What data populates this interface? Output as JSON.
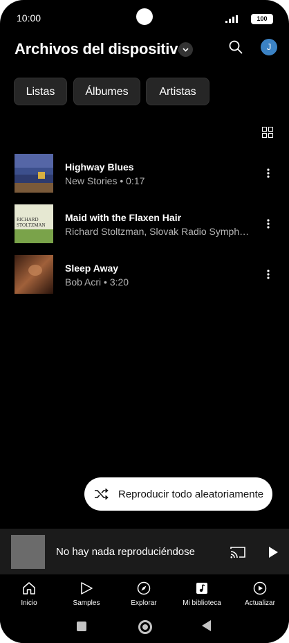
{
  "status_bar": {
    "time": "10:00",
    "battery": "100"
  },
  "header": {
    "title": "Archivos del dispositivo",
    "avatar_initial": "J"
  },
  "chips": [
    {
      "label": "Listas"
    },
    {
      "label": "Álbumes"
    },
    {
      "label": "Artistas"
    }
  ],
  "tracks": [
    {
      "title": "Highway Blues",
      "subtitle": "New Stories • 0:17"
    },
    {
      "title": "Maid with the Flaxen Hair",
      "subtitle": "Richard Stoltzman, Slovak Radio Sympho…",
      "art_text": "RICHARD STOLTZMAN"
    },
    {
      "title": "Sleep Away",
      "subtitle": "Bob Acri • 3:20"
    }
  ],
  "shuffle": {
    "label": "Reproducir todo aleatoriamente"
  },
  "miniplayer": {
    "text": "No hay nada reproduciéndose"
  },
  "bottom_nav": [
    {
      "label": "Inicio",
      "icon": "home-icon"
    },
    {
      "label": "Samples",
      "icon": "samples-icon"
    },
    {
      "label": "Explorar",
      "icon": "compass-icon"
    },
    {
      "label": "Mi biblioteca",
      "icon": "library-icon"
    },
    {
      "label": "Actualizar",
      "icon": "upgrade-icon"
    }
  ],
  "colors": {
    "background": "#000000",
    "avatar": "#3b82c4",
    "chip_bg": "#262626",
    "miniplayer_bg": "#1b1b1b"
  }
}
